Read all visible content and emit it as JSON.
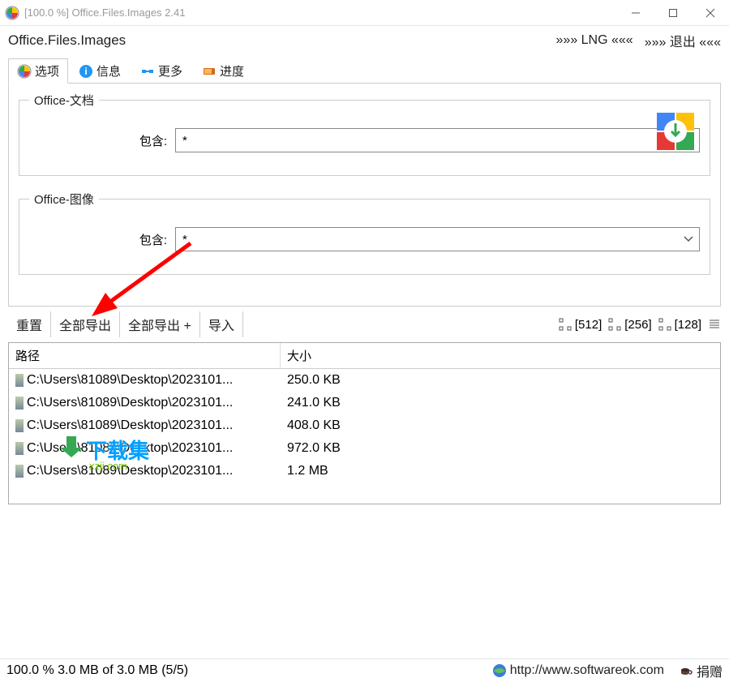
{
  "titlebar": {
    "title": "[100.0 %] Office.Files.Images 2.41"
  },
  "header": {
    "app_name": "Office.Files.Images",
    "lng": "»»» LNG «««",
    "exit": "»»» 退出 «««"
  },
  "tabs": {
    "options": "选项",
    "info": "信息",
    "more": "更多",
    "progress": "进度"
  },
  "groups": {
    "docs_legend": "Office-文档",
    "docs_label": "包含:",
    "docs_value": "*",
    "images_legend": "Office-图像",
    "images_label": "包含:",
    "images_value": "*"
  },
  "actions": {
    "reset": "重置",
    "export_all": "全部导出",
    "export_all_plus": "全部导出 +",
    "import": "导入"
  },
  "sizes": {
    "s512": "[512]",
    "s256": "[256]",
    "s128": "[128]"
  },
  "table": {
    "col_path": "路径",
    "col_size": "大小",
    "rows": [
      {
        "path": "C:\\Users\\81089\\Desktop\\2023101...",
        "size": "250.0 KB"
      },
      {
        "path": "C:\\Users\\81089\\Desktop\\2023101...",
        "size": "241.0 KB"
      },
      {
        "path": "C:\\Users\\81089\\Desktop\\2023101...",
        "size": "408.0 KB"
      },
      {
        "path": "C:\\Users\\81089\\Desktop\\2023101...",
        "size": "972.0 KB"
      },
      {
        "path": "C:\\Users\\81089\\Desktop\\2023101...",
        "size": "1.2 MB"
      }
    ]
  },
  "watermark": {
    "title": "下载集",
    "sub": "xzji.com"
  },
  "status": {
    "left": "100.0 % 3.0 MB of 3.0 MB (5/5)",
    "url": "http://www.softwareok.com",
    "donate": "捐赠"
  }
}
